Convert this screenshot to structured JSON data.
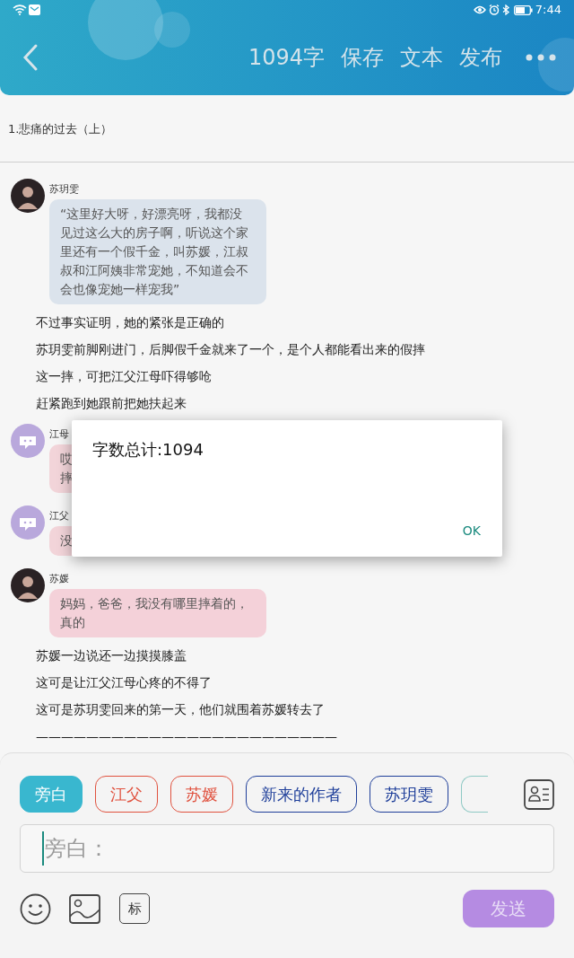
{
  "status_bar": {
    "time": "7:44"
  },
  "header": {
    "items": [
      {
        "label": "1094字"
      },
      {
        "label": "保存"
      },
      {
        "label": "文本"
      },
      {
        "label": "发布"
      }
    ]
  },
  "chapter_title": "1.悲痛的过去（上）",
  "messages": [
    {
      "kind": "dialogue",
      "speaker": "苏玥雯",
      "avatar": {
        "kind": "photo"
      },
      "color": "#dbe3ec",
      "lines": [
        "“这里好大呀，好漂亮呀，我都没",
        "见过这么大的房子啊，听说这个家",
        "里还有一个假千金，叫苏媛，江叔",
        "叔和江阿姨非常宠她，不知道会不",
        "会也像宠她一样宠我”"
      ]
    },
    {
      "kind": "narration",
      "text": "不过事实证明，她的紧张是正确的"
    },
    {
      "kind": "narration",
      "text": "苏玥雯前脚刚进门，后脚假千金就来了一个，是个人都能看出来的假摔"
    },
    {
      "kind": "narration",
      "text": "这一摔，可把江父江母吓得够呛"
    },
    {
      "kind": "narration",
      "text": "赶紧跑到她跟前把她扶起来"
    },
    {
      "kind": "dialogue",
      "speaker": "江母",
      "avatar": {
        "kind": "default"
      },
      "color": "#f2d4d9",
      "lines": [
        "哎",
        "摔"
      ]
    },
    {
      "kind": "dialogue",
      "speaker": "江父",
      "avatar": {
        "kind": "default"
      },
      "color": "#f2d4d9",
      "lines": [
        "没"
      ]
    },
    {
      "kind": "dialogue",
      "speaker": "苏媛",
      "avatar": {
        "kind": "photo"
      },
      "color": "#f4d1d9",
      "lines": [
        "妈妈，爸爸，我没有哪里摔着的，",
        "真的"
      ]
    },
    {
      "kind": "narration",
      "text": "苏媛一边说还一边摸摸膝盖"
    },
    {
      "kind": "narration",
      "text": "这可是让江父江母心疼的不得了"
    },
    {
      "kind": "narration",
      "text": "这可是苏玥雯回来的第一天，他们就围着苏媛转去了"
    },
    {
      "kind": "narration",
      "text": "————————————————————————"
    }
  ],
  "dialog": {
    "message": "字数总计:1094",
    "button": "OK"
  },
  "composer": {
    "chips": [
      {
        "label": "旁白",
        "selected": true,
        "color": "#39b7cf"
      },
      {
        "label": "江父",
        "selected": false,
        "color": "#e0523f"
      },
      {
        "label": "苏媛",
        "selected": false,
        "color": "#e0523f"
      },
      {
        "label": "新来的作者",
        "selected": false,
        "color": "#1f3f9a"
      },
      {
        "label": "苏玥雯",
        "selected": false,
        "color": "#1f3f9a"
      }
    ],
    "placeholder": "旁白：",
    "tag_button": "标",
    "send": "发送"
  }
}
